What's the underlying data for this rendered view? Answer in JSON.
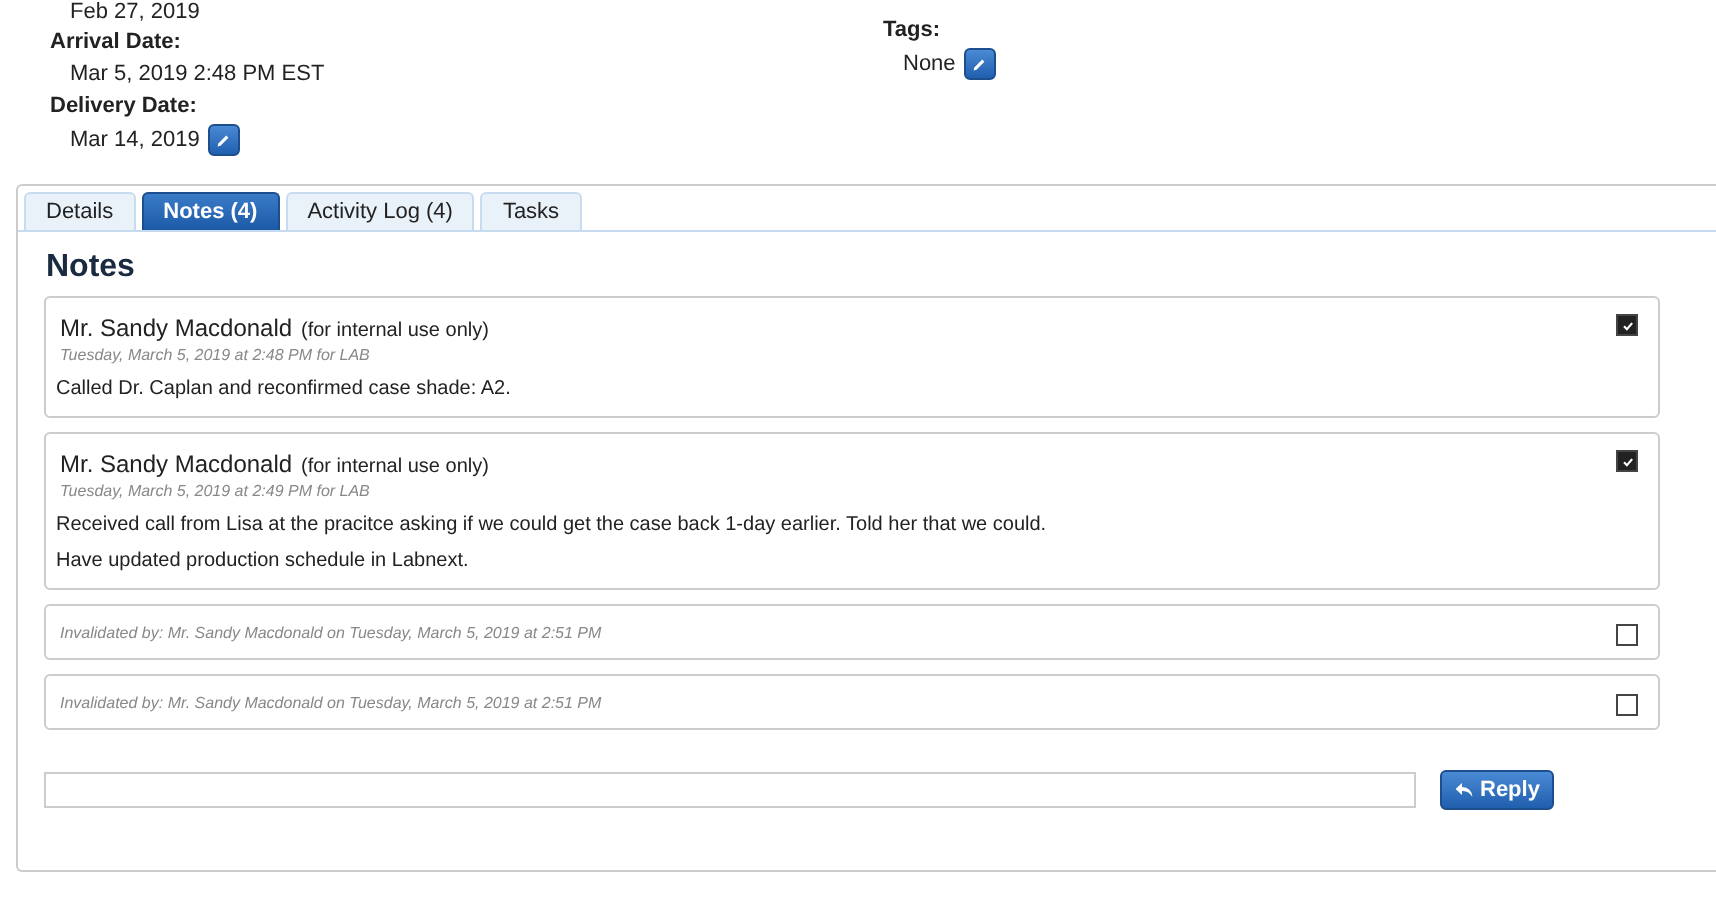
{
  "header": {
    "previous_date": "Feb 27, 2019",
    "arrival_label": "Arrival Date:",
    "arrival_value": "Mar 5, 2019 2:48 PM EST",
    "delivery_label": "Delivery Date:",
    "delivery_value": "Mar 14, 2019",
    "tags_label": "Tags:",
    "tags_value": "None"
  },
  "tabs": [
    {
      "label": "Details",
      "selected": false
    },
    {
      "label": "Notes (4)",
      "selected": true
    },
    {
      "label": "Activity Log (4)",
      "selected": false
    },
    {
      "label": "Tasks",
      "selected": false
    }
  ],
  "notes_heading": "Notes",
  "notes": [
    {
      "kind": "note",
      "author": "Mr. Sandy Macdonald",
      "visibility": "(for internal use only)",
      "timestamp": "Tuesday, March 5, 2019 at 2:48 PM for LAB",
      "paragraphs": [
        "Called Dr. Caplan and reconfirmed case shade: A2."
      ],
      "checked": true
    },
    {
      "kind": "note",
      "author": "Mr. Sandy Macdonald",
      "visibility": "(for internal use only)",
      "timestamp": "Tuesday, March 5, 2019 at 2:49 PM for LAB",
      "paragraphs": [
        "Received call from Lisa at the pracitce asking if we could get the case back 1-day earlier.  Told her that we could.",
        "Have updated production schedule in Labnext."
      ],
      "checked": true
    },
    {
      "kind": "invalidated",
      "text": "Invalidated by: Mr. Sandy Macdonald on Tuesday, March 5, 2019 at 2:51 PM",
      "checked": false
    },
    {
      "kind": "invalidated",
      "text": "Invalidated by: Mr. Sandy Macdonald on Tuesday, March 5, 2019 at 2:51 PM",
      "checked": false
    }
  ],
  "reply_button": "Reply"
}
